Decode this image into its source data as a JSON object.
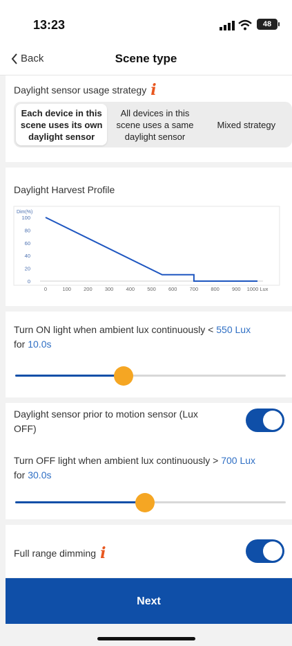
{
  "status": {
    "time": "13:23",
    "battery": "48"
  },
  "nav": {
    "back_label": "Back",
    "title": "Scene type"
  },
  "strategy": {
    "label": "Daylight sensor usage strategy",
    "options": [
      {
        "label": "Each device in this scene uses its own daylight sensor",
        "selected": true
      },
      {
        "label": "All devices in this scene uses a same daylight sensor",
        "selected": false
      },
      {
        "label": "Mixed strategy",
        "selected": false
      }
    ]
  },
  "profile": {
    "label": "Daylight Harvest Profile",
    "chart_data": {
      "type": "line",
      "ylabel": "Dim(%)",
      "xunit": "Lux",
      "x_ticks": [
        "0",
        "100",
        "200",
        "300",
        "400",
        "500",
        "600",
        "700",
        "800",
        "900",
        "1000"
      ],
      "y_ticks": [
        "0",
        "20",
        "40",
        "60",
        "80",
        "100"
      ],
      "xlim": [
        0,
        1000
      ],
      "ylim": [
        0,
        100
      ],
      "points": [
        [
          0,
          100
        ],
        [
          550,
          10
        ],
        [
          700,
          10
        ],
        [
          700,
          0
        ],
        [
          1000,
          0
        ]
      ],
      "line_color": "#1e56c0"
    }
  },
  "turn_on": {
    "prefix": "Turn ON light when ambient lux continuously < ",
    "lux": "550 Lux",
    "for_prefix": "for ",
    "duration": "10.0s",
    "slider_fraction": 0.4
  },
  "prior": {
    "label": "Daylight sensor prior to motion sensor (Lux OFF)",
    "on": true
  },
  "turn_off": {
    "prefix": "Turn OFF light when ambient lux continuously > ",
    "lux": "700 Lux",
    "for_prefix": "for ",
    "duration": "30.0s",
    "slider_fraction": 0.48
  },
  "full_range": {
    "label": "Full range dimming",
    "on": true
  },
  "next_label": "Next",
  "colors": {
    "primary": "#0f4fa8",
    "accent": "#f5a623",
    "info": "#e8571f"
  }
}
